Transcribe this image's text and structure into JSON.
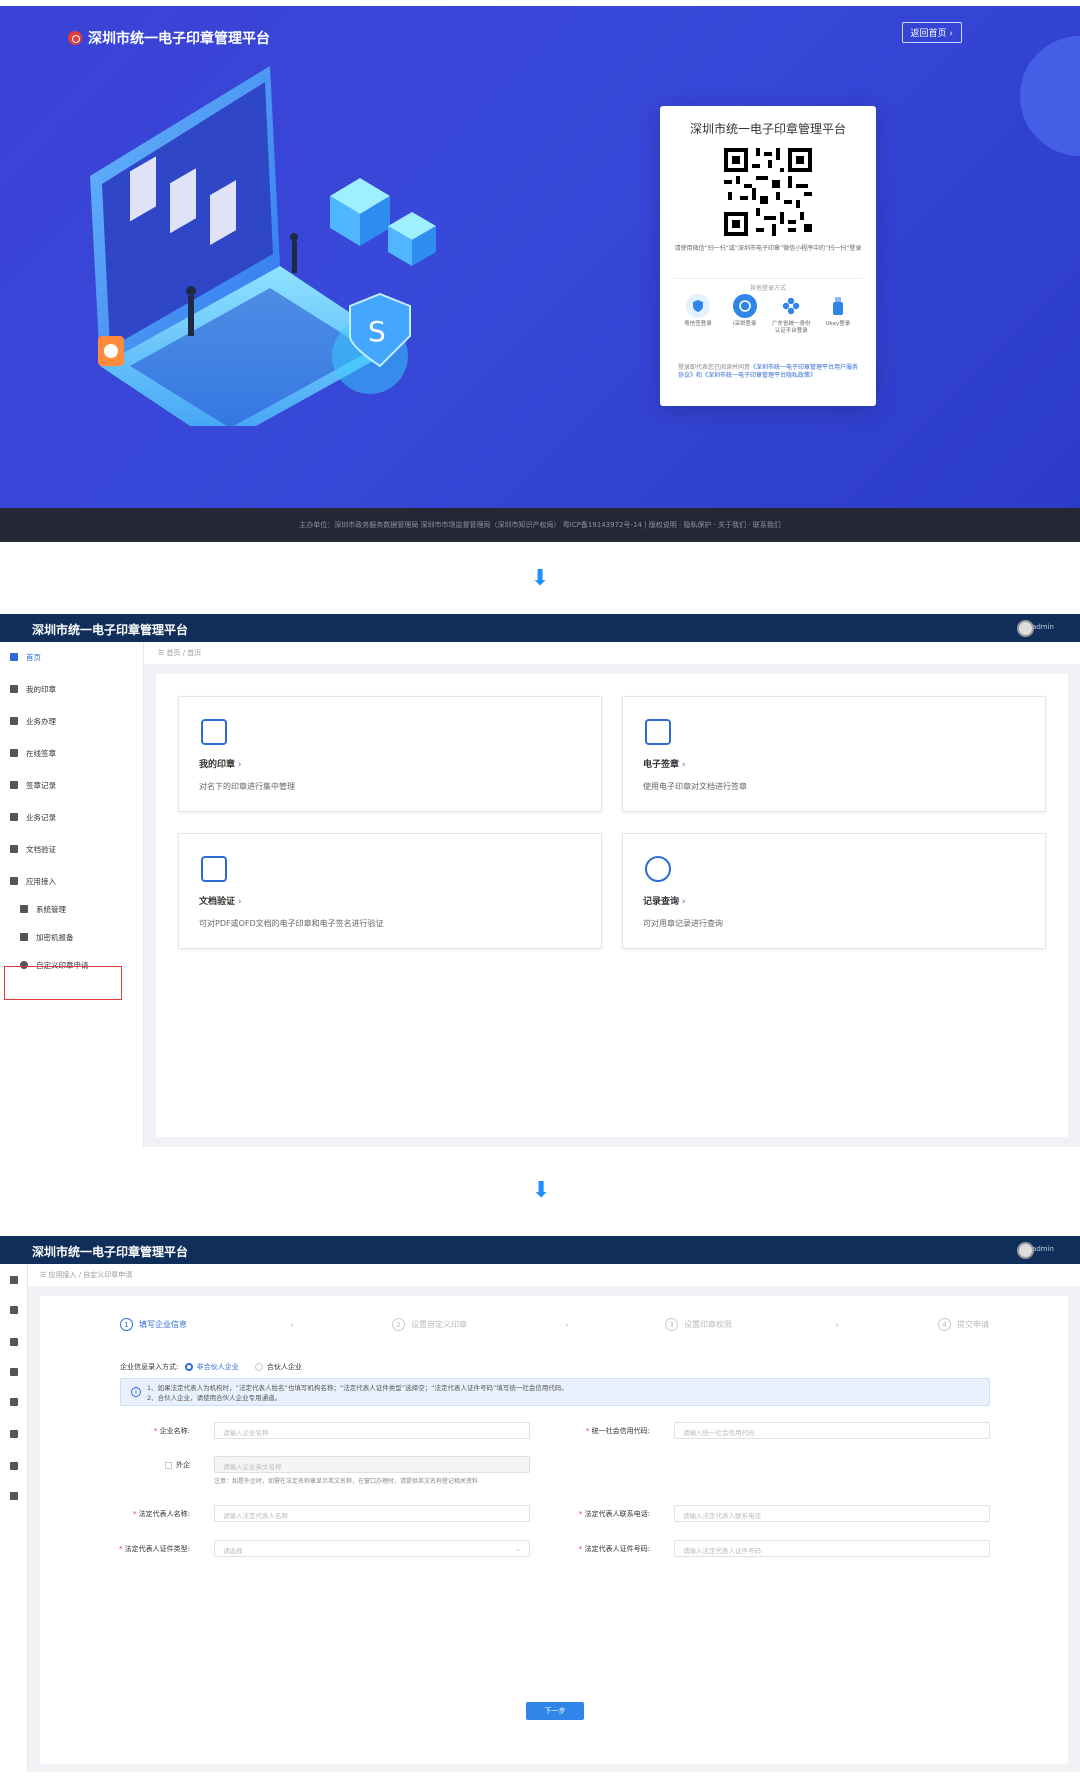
{
  "login": {
    "brand": "深圳市统一电子印章管理平台",
    "back_home": "返回首页 ›",
    "card_title": "深圳市统一电子印章管理平台",
    "scan_hint": "请使用微信“扫一扫”或“深圳市电子印章”微信小程序中的“扫一扫”登录",
    "other_methods": "其他登录方式",
    "methods": [
      "粤信签登录",
      "i深圳登录",
      "广东省统一身份认证平台登录",
      "Ukey登录"
    ],
    "agree_prefix": "登录即代表您已阅读并同意",
    "agree_links": "《深圳市统一电子印章管理平台用户服务协议》和《深圳市统一电子印章管理平台隐私政策》",
    "footer": "主办单位：深圳市政务服务数据管理局 深圳市市场监督管理局（深圳市知识产权局） 粤ICP备19143972号-14 | 版权说明 · 隐私保护 · 关于我们 · 联系我们"
  },
  "app": {
    "title": "深圳市统一电子印章管理平台",
    "user": "admin"
  },
  "home": {
    "breadcrumb": "☰    首页  /  首页",
    "sidebar": [
      "首页",
      "我的印章",
      "业务办理",
      "在线签章",
      "签章记录",
      "业务记录",
      "文档验证",
      "应用接入",
      "系统管理",
      "加密机报备",
      "自定义印章申请"
    ],
    "cards": [
      {
        "title": "我的印章",
        "desc": "对名下的印章进行集中管理"
      },
      {
        "title": "电子签章",
        "desc": "使用电子印章对文档进行签章"
      },
      {
        "title": "文档验证",
        "desc": "可对PDF或OFD文档的电子印章和电子签名进行验证"
      },
      {
        "title": "记录查询",
        "desc": "可对用章记录进行查询"
      }
    ]
  },
  "form": {
    "breadcrumb": "☰    应用接入  /  自定义印章申请",
    "steps": [
      "填写企业信息",
      "设置自定义印章",
      "设置印章权限",
      "提交申请"
    ],
    "step_nums": [
      "1",
      "2",
      "3",
      "4"
    ],
    "entry_label": "企业信息录入方式:",
    "entry_opt1": "非合伙人企业",
    "entry_opt2": "合伙人企业",
    "info_line1": "1、如果法定代表人为机构时，“法定代表人姓名”也填写机构名称；“法定代表人证件类型”选择空；“法定代表人证件号码”填写统一社会信用代码。",
    "info_line2": "2、合伙人企业，请使用合伙人企业专用通道。",
    "company_name": "企业名称:",
    "company_ph": "请输入企业名称",
    "credit_code": "统一社会信用代码:",
    "credit_ph": "请输入统一社会信用代码",
    "foreign": "外企",
    "foreign_ph": "请输入企业英文名称",
    "foreign_note": "注意：如是外企时，如需在法定名称章显示英文名称，在窗口办理时，请提供英文名称登记相关资料",
    "rep_name": "法定代表人名称:",
    "rep_name_ph": "请输入法定代表人名称",
    "rep_phone": "法定代表人联系电话:",
    "rep_phone_ph": "请输入法定代表人联系电话",
    "id_type": "法定代表人证件类型:",
    "id_type_ph": "请选择",
    "id_no": "法定代表人证件号码:",
    "id_no_ph": "请输入法定代表人证件号码",
    "next": "下一步"
  },
  "colors": {
    "brand_blue": "#3a42d6",
    "nav_dark": "#0f2f5a",
    "accent": "#2f6bd6",
    "highlight_red": "#e03b3b"
  }
}
